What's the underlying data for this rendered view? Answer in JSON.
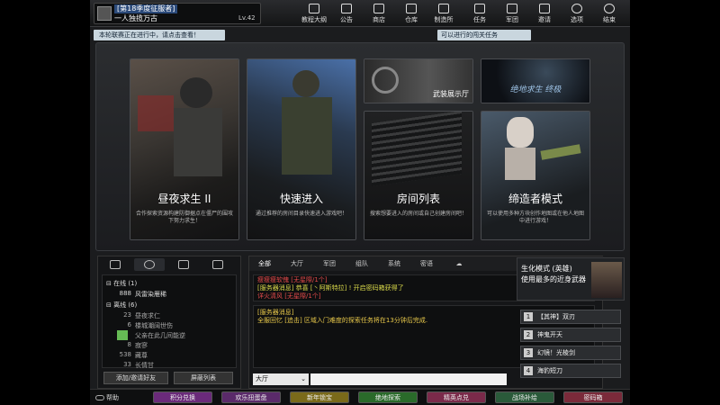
{
  "profile": {
    "season": "[第18季度征服者]",
    "name": "一人独揽万古",
    "level": "Lv.42"
  },
  "nav": [
    {
      "label": "教程大纲",
      "icon": "book-icon"
    },
    {
      "label": "公告",
      "icon": "megaphone-icon"
    },
    {
      "label": "商店",
      "icon": "shop-icon"
    },
    {
      "label": "仓库",
      "icon": "warehouse-icon"
    },
    {
      "label": "制造所",
      "icon": "factory-icon"
    },
    {
      "label": "任务",
      "icon": "mission-icon"
    },
    {
      "label": "军团",
      "icon": "clan-icon"
    },
    {
      "label": "邀请",
      "icon": "mail-icon"
    },
    {
      "label": "选项",
      "icon": "gear-icon"
    },
    {
      "label": "结束",
      "icon": "power-icon"
    }
  ],
  "notices": {
    "left": "本轮联赛正在进行中，请点击查看！",
    "right": "可以进行的闯关任务"
  },
  "cards": [
    {
      "title": "昼夜求生 II",
      "desc": "合作探索资源构建防御据点在僵尸的围攻下努力求生！"
    },
    {
      "title": "快速进入",
      "desc": "通过推荐的房间目录快速进入游戏吧！"
    },
    {
      "title": "武装展示厅",
      "desc": ""
    },
    {
      "title": "绝地求生 终极",
      "desc": ""
    },
    {
      "title": "房间列表",
      "desc": "搜索想要进入的房间或自己创建房间吧！"
    },
    {
      "title": "缔造者模式",
      "desc": "可以使用多种方块创作地图或在他人地图中进行游戏！"
    }
  ],
  "friends": {
    "online_header": "在线 (1)",
    "online": [
      {
        "level": "888",
        "name": "风雷染雁稀"
      }
    ],
    "offline_header": "离线 (6)",
    "offline": [
      {
        "level": "23",
        "name": "昼夜求仁"
      },
      {
        "level": "6",
        "name": "楼城潮阔世伤"
      },
      {
        "level": "23",
        "name": "父亲在此几间能逆"
      },
      {
        "level": "8",
        "name": "寂寥"
      },
      {
        "level": "538",
        "name": "藏尊"
      },
      {
        "level": "33",
        "name": "长情甘"
      }
    ],
    "add_button": "添加/邀请好友",
    "block_button": "屏蔽列表"
  },
  "chat": {
    "tabs": [
      "全部",
      "大厅",
      "军团",
      "组队",
      "系统",
      "密语"
    ],
    "log1": [
      {
        "text": "瘦瘦瘦软傀 [无星際/1个]",
        "color": "#e24a4a"
      },
      {
        "text": "[服务器消息] 恭喜 [丶阿斯特拉] ! 开启密码箱获得了",
        "color": "#d9d94a"
      },
      {
        "text": "详火清风 [无星際/1个]",
        "color": "#e24a4a"
      }
    ],
    "log2": [
      {
        "text": "[服务器消息]",
        "color": "#e8c84a"
      },
      {
        "text": "全服回忆 [追击] 区域入门难度的探索任务将在13分钟后完成.",
        "color": "#e8c84a"
      }
    ],
    "channel": "大厅"
  },
  "side": {
    "ad_line1": "生化模式 (英雄)",
    "ad_line2": "使用最多的近身武器",
    "modes": [
      {
        "num": "1",
        "label": "【其神】双刃"
      },
      {
        "num": "2",
        "label": "神鬼开天"
      },
      {
        "num": "3",
        "label": "幻镜！光棱剑"
      },
      {
        "num": "4",
        "label": "海豹短刀"
      }
    ]
  },
  "bottom": {
    "help": "帮助",
    "buttons": [
      {
        "label": "积分兑换",
        "color": "#6a2a7a"
      },
      {
        "label": "欢乐扭蛋盘",
        "color": "#5a2a6a"
      },
      {
        "label": "新年锁宝",
        "color": "#7a6a1a"
      },
      {
        "label": "绝地探索",
        "color": "#2a6a2a"
      },
      {
        "label": "精英点兑",
        "color": "#7a2a4a"
      },
      {
        "label": "战场补给",
        "color": "#2a5a3a"
      },
      {
        "label": "密码箱",
        "color": "#7a2a3a"
      }
    ]
  }
}
